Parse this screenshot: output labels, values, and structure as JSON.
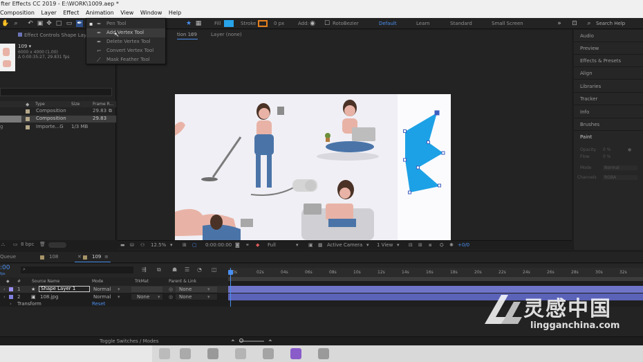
{
  "window": {
    "title": "fter Effects CC 2019 - E:\\WORK\\1009.aep *"
  },
  "menu": [
    "Composition",
    "Layer",
    "Effect",
    "Animation",
    "View",
    "Window",
    "Help"
  ],
  "toolbar": {
    "fill_label": "Fill",
    "stroke_label": "Stroke",
    "stroke_width": "0 px",
    "add_label": "Add:",
    "rotobezier_label": "RotoBezier",
    "fill_color": "#29a3ea",
    "stroke_color": "#e8801e"
  },
  "workspaces": [
    "Default",
    "Learn",
    "Standard",
    "Small Screen"
  ],
  "search_help": "Search Help",
  "pen_menu": {
    "items": [
      "Pen Tool",
      "Add Vertex Tool",
      "Delete Vertex Tool",
      "Convert Vertex Tool",
      "Mask Feather Tool"
    ],
    "selected": "Add Vertex Tool"
  },
  "effect_controls_tab": "Effect Controls Shape Laye",
  "comp_tab": "tion 109",
  "layer_tab": "Layer  (none)",
  "project": {
    "selected_name": "109 ▾",
    "info1": "6000 x 4000 (1.00)",
    "info2": "Δ 0:00:35:27, 29.831 fps",
    "columns": {
      "type": "Type",
      "size": "Size",
      "frame_rate": "Frame R..."
    },
    "rows": [
      {
        "type": "Composition",
        "size": "",
        "fps": "29.83"
      },
      {
        "type": "Composition",
        "size": "",
        "fps": "29.83"
      },
      {
        "type": "Importe...G",
        "size": "1/3 MB",
        "fps": ""
      }
    ],
    "bpc": "8 bpc"
  },
  "right_panel": [
    "Audio",
    "Preview",
    "Effects & Presets",
    "Align",
    "Libraries",
    "Tracker",
    "Info",
    "Brushes",
    "Paint"
  ],
  "paint": {
    "opacity": "Opacity",
    "flow": "Flow",
    "mode": "Mode",
    "mode_val": "Normal",
    "channels": "Channels",
    "channels_val": "RGBA",
    "op_val": "0 %",
    "flow_val": "0 %"
  },
  "comp_bar": {
    "zoom": "12.5%",
    "timecode": "0:00:00:00",
    "resolution": "Full",
    "camera": "Active Camera",
    "view": "1 View",
    "offset": "+0/0"
  },
  "timeline": {
    "queue_label": "Queue",
    "tabs": [
      "108",
      "109"
    ],
    "current_time": ":00",
    "current_time_sub": "fps",
    "columns": {
      "num": "#",
      "source": "Source Name",
      "mode": "Mode",
      "trkmat": "TrkMat",
      "parent": "Parent & Link"
    },
    "layers": [
      {
        "num": "1",
        "name": "Shape Layer 1",
        "mode": "Normal",
        "trkmat": "",
        "parent": "None",
        "color": "#9b8ff0"
      },
      {
        "num": "2",
        "name": "108.jpg",
        "mode": "Normal",
        "trkmat": "None",
        "parent": "None",
        "color": "#7f7fe0"
      }
    ],
    "transform_label": "Transform",
    "reset_label": "Reset",
    "ruler": [
      "0s",
      "02s",
      "04s",
      "06s",
      "08s",
      "10s",
      "12s",
      "14s",
      "16s",
      "18s",
      "20s",
      "22s",
      "24s",
      "26s",
      "28s",
      "30s",
      "32s",
      "34"
    ],
    "footer": "Toggle Switches / Modes"
  },
  "watermark": {
    "cn": "灵感中国",
    "en": "lingganchina.com"
  }
}
